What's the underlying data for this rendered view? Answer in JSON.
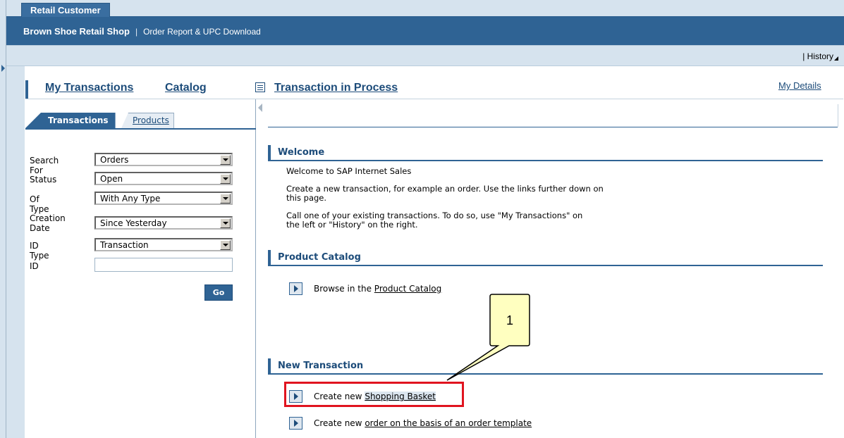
{
  "header": {
    "app_tab": "Retail Customer",
    "shop_name": "Brown Shoe Retail Shop",
    "separator": "|",
    "report_link": "Order Report & UPC Download"
  },
  "subbar": {
    "history_prefix": "|",
    "history_label": "History"
  },
  "topnav": {
    "my_transactions": "My Transactions",
    "catalog": "Catalog",
    "transaction_in_process": "Transaction in Process",
    "my_details": "My Details"
  },
  "left_panel": {
    "tabs": [
      {
        "label": "Transactions",
        "active": true
      },
      {
        "label": "Products",
        "active": false
      }
    ],
    "form": {
      "search_for": {
        "label": "Search For",
        "value": "Orders"
      },
      "status": {
        "label": "Status",
        "value": "Open"
      },
      "of_type": {
        "label": "Of Type",
        "value": "With Any Type"
      },
      "creation_date": {
        "label": "Creation Date",
        "value": "Since Yesterday"
      },
      "id_type": {
        "label": "ID Type",
        "value": "Transaction"
      },
      "id": {
        "label": "ID",
        "value": ""
      }
    },
    "go_button": "Go"
  },
  "welcome": {
    "title": "Welcome",
    "line1": "Welcome to SAP Internet Sales",
    "line2": "Create a new transaction, for example an order. Use the links further down on this page.",
    "line3": "Call one of your existing transactions. To do so, use \"My Transactions\" on the left or \"History\" on the right."
  },
  "product_catalog": {
    "title": "Product Catalog",
    "item_prefix": "Browse in the",
    "item_link": "Product Catalog"
  },
  "new_transaction": {
    "title": "New Transaction",
    "items": [
      {
        "prefix": "Create new",
        "link": "Shopping Basket"
      },
      {
        "prefix": "Create new",
        "link": "order on the basis of an order template"
      }
    ]
  },
  "callout": {
    "number": "1",
    "fill": "#ffffc0",
    "border": "#000000",
    "highlight": "#e0141f"
  },
  "colors": {
    "nav_blue": "#2f6394",
    "light_blue": "#d6e3ee",
    "link_blue": "#1d4c7a"
  }
}
